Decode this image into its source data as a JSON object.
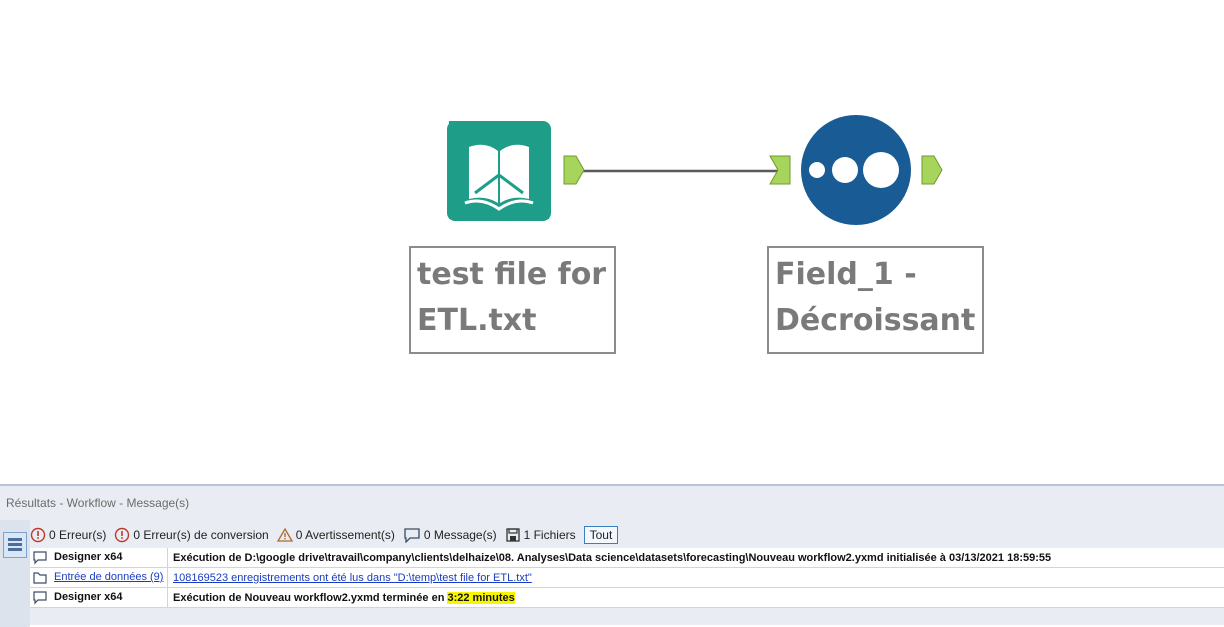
{
  "workflow": {
    "input_tool": {
      "name": "Entrée de données",
      "label": "test file for\nETL.txt"
    },
    "sort_tool": {
      "name": "Trier",
      "label": "Field_1 -\nDécroissant"
    },
    "colors": {
      "input": "#1e9e88",
      "sort": "#195b94",
      "anchor": "#a7d45a",
      "connection": "#595959"
    }
  },
  "results": {
    "title": "Résultats - Workflow - Message(s)",
    "filters": [
      {
        "icon": "error-icon",
        "label": "0 Erreur(s)"
      },
      {
        "icon": "conversion-error-icon",
        "label": "0 Erreur(s) de conversion"
      },
      {
        "icon": "warning-icon",
        "label": "0 Avertissement(s)"
      },
      {
        "icon": "message-icon",
        "label": "0 Message(s)"
      },
      {
        "icon": "file-icon",
        "label": "1 Fichiers"
      }
    ],
    "all_button": "Tout",
    "rows": [
      {
        "icon": "message-icon",
        "source": "Designer x64",
        "message": "Exécution de D:\\google drive\\travail\\company\\clients\\delhaize\\08. Analyses\\Data science\\datasets\\forecasting\\Nouveau workflow2.yxmd initialisée à 03/13/2021 18:59:55"
      },
      {
        "icon": "file-icon",
        "source": "Entrée de données (9)",
        "message": "108169523 enregistrements ont été lus dans \"D:\\temp\\test file for ETL.txt\""
      },
      {
        "icon": "message-icon",
        "source": "Designer x64",
        "message_prefix": "Exécution de Nouveau workflow2.yxmd terminée en ",
        "message_highlight": "3:22 minutes"
      }
    ]
  }
}
